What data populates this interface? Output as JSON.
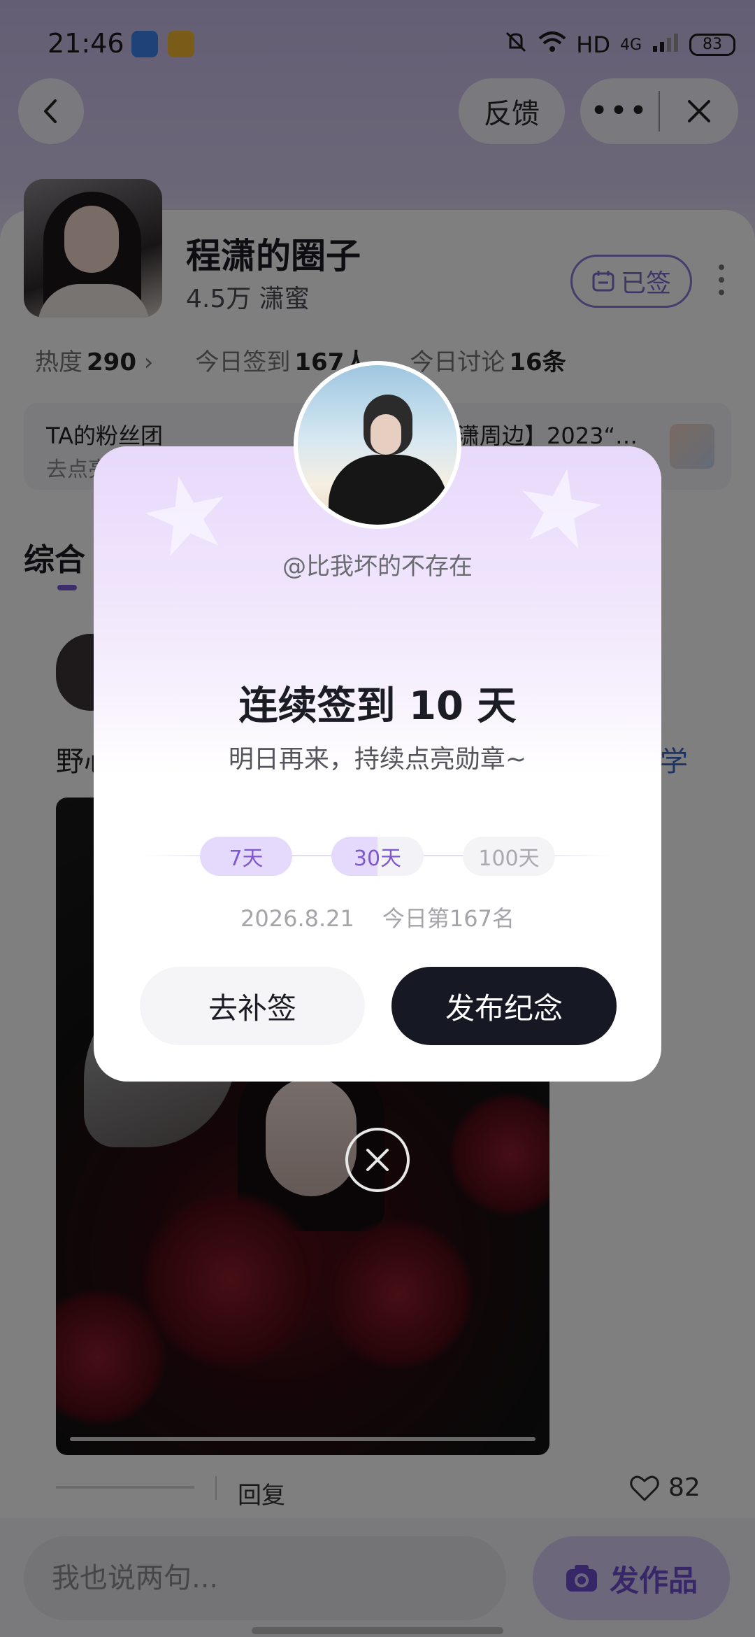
{
  "status_bar": {
    "time": "21:46",
    "network": "HD",
    "network_gen": "4G",
    "battery": "83"
  },
  "nav": {
    "feedback_label": "反馈",
    "more_icon": "more-horizontal-icon",
    "close_icon": "close-icon",
    "back_icon": "back-arrow-icon"
  },
  "circle": {
    "name": "程潇的圈子",
    "fans_count": "4.5万",
    "fans_label": "潇蜜",
    "signed_label": "已签",
    "stats": [
      {
        "label": "热度",
        "value": "290"
      },
      {
        "label": "今日签到",
        "value": "167人"
      },
      {
        "label": "今日讨论",
        "value": "16条"
      }
    ],
    "fan_club_title": "TA的粉丝团",
    "fan_club_sub": "去点亮",
    "promo_text": "潇周边】2023“…",
    "tab_active": "综合"
  },
  "post": {
    "text_left": "野心",
    "text_right": "学",
    "reply_label": "回复",
    "likes": "82"
  },
  "bottom_bar": {
    "comment_placeholder": "我也说两句...",
    "post_button": "发作品"
  },
  "modal": {
    "username": "@比我坏的不存在",
    "title": "连续签到 10 天",
    "subtitle": "明日再来，持续点亮勋章~",
    "milestones": [
      {
        "label": "7天",
        "reached": true
      },
      {
        "label": "30天",
        "progress": 0.33
      },
      {
        "label": "100天",
        "reached": false
      }
    ],
    "date": "2026.8.21",
    "rank": "今日第167名",
    "makeup_button": "去补签",
    "publish_button": "发布纪念"
  },
  "colors": {
    "accent": "#7f58cf",
    "dark_button": "#161823",
    "link": "#3a66c9"
  }
}
